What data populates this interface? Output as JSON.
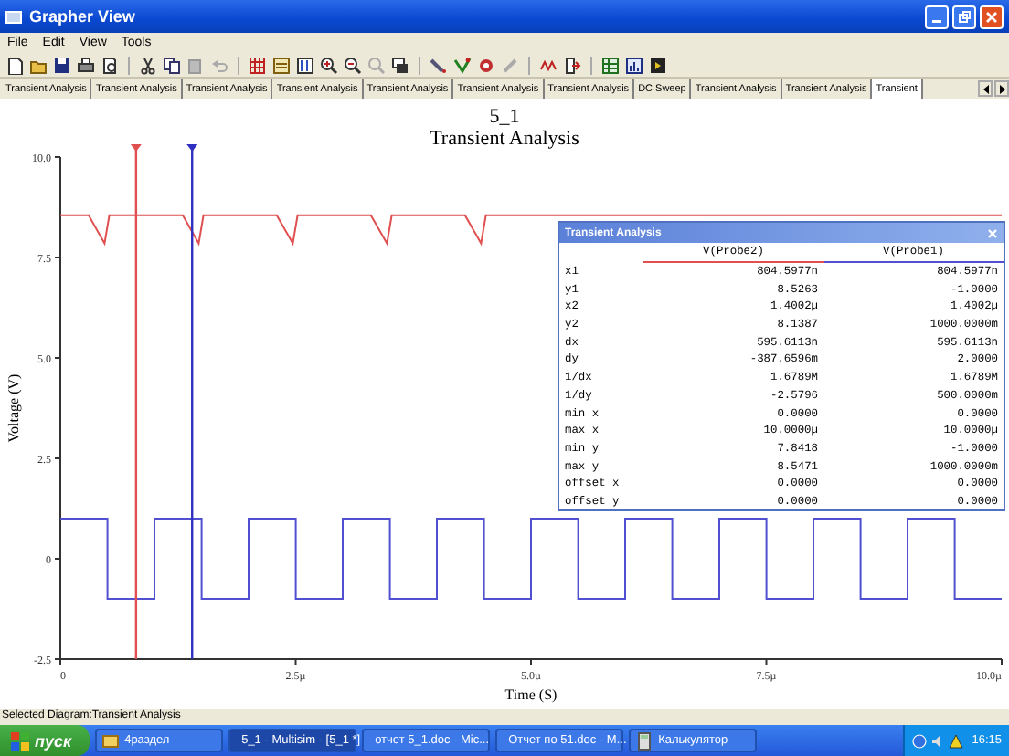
{
  "window": {
    "title": "Grapher View"
  },
  "menu": [
    "File",
    "Edit",
    "View",
    "Tools"
  ],
  "tabs": [
    {
      "label": "Transient Analysis",
      "selected": false
    },
    {
      "label": "Transient Analysis",
      "selected": false
    },
    {
      "label": "Transient Analysis",
      "selected": false
    },
    {
      "label": "Transient Analysis",
      "selected": false
    },
    {
      "label": "Transient Analysis",
      "selected": false
    },
    {
      "label": "Transient Analysis",
      "selected": false
    },
    {
      "label": "Transient Analysis",
      "selected": false
    },
    {
      "label": "DC Sweep",
      "selected": false
    },
    {
      "label": "Transient Analysis",
      "selected": false
    },
    {
      "label": "Transient Analysis",
      "selected": false
    },
    {
      "label": "Transient",
      "selected": true
    }
  ],
  "graph": {
    "diagram_name": "5_1",
    "chart_data": {
      "type": "line",
      "title": "Transient Analysis",
      "xlabel": "Time (S)",
      "ylabel": "Voltage (V)",
      "xlim": [
        0,
        10
      ],
      "ylim": [
        -2.5,
        10
      ],
      "xticks": [
        {
          "value": 0,
          "label": "0"
        },
        {
          "value": 2.5,
          "label": "2.5µ"
        },
        {
          "value": 5,
          "label": "5.0µ"
        },
        {
          "value": 7.5,
          "label": "7.5µ"
        },
        {
          "value": 10,
          "label": "10.0µ"
        }
      ],
      "yticks": [
        {
          "value": -2.5,
          "label": "-2.5"
        },
        {
          "value": 0,
          "label": "0"
        },
        {
          "value": 2.5,
          "label": "2.5"
        },
        {
          "value": 5,
          "label": "5.0"
        },
        {
          "value": 7.5,
          "label": "7.5"
        },
        {
          "value": 10,
          "label": "10.0"
        }
      ],
      "series": [
        {
          "name": "V(Probe2)",
          "color": "#e05050",
          "x": [
            0,
            0.3,
            0.47,
            0.52,
            1,
            1.3,
            1.47,
            1.52,
            2,
            2.3,
            2.47,
            2.52,
            3,
            3.3,
            3.47,
            3.52,
            4,
            4.3,
            4.47,
            4.52,
            5,
            5.3,
            5.52,
            6,
            6.3,
            6.52,
            7,
            7.3,
            7.52,
            8,
            8.3,
            8.52,
            9,
            9.3,
            9.52,
            10
          ],
          "values": [
            8.55,
            8.55,
            7.85,
            8.55,
            8.55,
            8.55,
            7.85,
            8.55,
            8.55,
            8.55,
            7.85,
            8.55,
            8.55,
            8.55,
            7.85,
            8.55,
            8.55,
            8.55,
            7.85,
            8.55,
            8.55,
            8.55,
            8.55,
            8.55,
            8.55,
            8.55,
            8.55,
            8.55,
            8.55,
            8.55,
            8.55,
            8.55,
            8.55,
            8.55,
            8.55,
            8.55
          ]
        },
        {
          "name": "V(Probe1)",
          "color": "#5050d0",
          "x": [
            0,
            0.5,
            0.5,
            1,
            1,
            1.5,
            1.5,
            2,
            2,
            2.5,
            2.5,
            3,
            3,
            3.5,
            3.5,
            4,
            4,
            4.5,
            4.5,
            5,
            5,
            5.5,
            5.5,
            6,
            6,
            6.5,
            6.5,
            7,
            7,
            7.5,
            7.5,
            8,
            8,
            8.5,
            8.5,
            9,
            9,
            9.5,
            9.5,
            10
          ],
          "values": [
            1,
            1,
            -1,
            -1,
            1,
            1,
            -1,
            -1,
            1,
            1,
            -1,
            -1,
            1,
            1,
            -1,
            -1,
            1,
            1,
            -1,
            -1,
            1,
            1,
            -1,
            -1,
            1,
            1,
            -1,
            -1,
            1,
            1,
            -1,
            -1,
            1,
            1,
            -1,
            -1,
            1,
            1,
            -1,
            -1
          ]
        }
      ],
      "ref_lines": [
        {
          "axis": "x",
          "value": 0.8046,
          "color": "#e05050"
        },
        {
          "axis": "x",
          "value": 1.4002,
          "color": "#3030c0"
        }
      ]
    }
  },
  "cursor_window": {
    "title": "Transient Analysis",
    "rows": [
      [
        "x1",
        "804.5977n",
        "804.5977n"
      ],
      [
        "y1",
        "8.5263",
        "-1.0000"
      ],
      [
        "x2",
        "1.4002µ",
        "1.4002µ"
      ],
      [
        "y2",
        "8.1387",
        "1000.0000m"
      ],
      [
        "dx",
        "595.6113n",
        "595.6113n"
      ],
      [
        "dy",
        "-387.6596m",
        "2.0000"
      ],
      [
        "1/dx",
        "1.6789M",
        "1.6789M"
      ],
      [
        "1/dy",
        "-2.5796",
        "500.0000m"
      ],
      [
        "min x",
        "0.0000",
        "0.0000"
      ],
      [
        "max x",
        "10.0000µ",
        "10.0000µ"
      ],
      [
        "min y",
        "7.8418",
        "-1.0000"
      ],
      [
        "max y",
        "8.5471",
        "1000.0000m"
      ],
      [
        "offset x",
        "0.0000",
        "0.0000"
      ],
      [
        "offset y",
        "0.0000",
        "0.0000"
      ]
    ]
  },
  "status_bar": "Selected Diagram:Transient Analysis",
  "taskbar": {
    "start": "пуск",
    "items": [
      {
        "label": "4раздел",
        "selected": false
      },
      {
        "label": "5_1 - Multisim - [5_1 *]",
        "selected": true
      },
      {
        "label": "отчет 5_1.doc - Mic...",
        "selected": false
      },
      {
        "label": "Отчет по 51.doc - M...",
        "selected": false
      },
      {
        "label": "Калькулятор",
        "selected": false
      }
    ],
    "clock": "16:15"
  }
}
